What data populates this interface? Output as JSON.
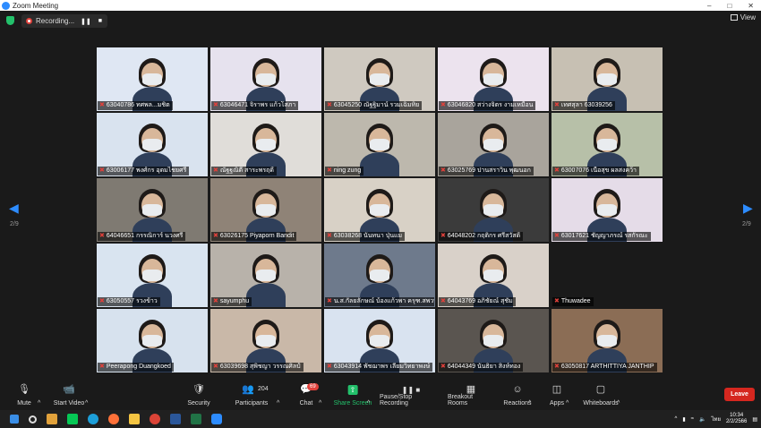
{
  "window": {
    "title": "Zoom Meeting"
  },
  "recording": {
    "status_label": "Recording..."
  },
  "view": {
    "label": "View"
  },
  "gallery": {
    "left_page": "2/9",
    "right_page": "2/9",
    "tiles": [
      {
        "name": "63040786 ทศพล...มชิต",
        "bg": "#dfe7f3"
      },
      {
        "name": "63046471 จิราพร แก้วโสภา",
        "bg": "#e6e2ee"
      },
      {
        "name": "63045250 ณัฐฐิมาน์ รวมเฉิมทิย",
        "bg": "#cfc9c0"
      },
      {
        "name": "63046820 สว่างจิตร งามเหมือน",
        "bg": "#ece3ee"
      },
      {
        "name": "เทศสุลา 63039256",
        "bg": "#c7c0b3"
      },
      {
        "name": "63006177 พงศ์กร อุดมไชยศรี",
        "bg": "#d9e3ef"
      },
      {
        "name": "ณัฐฐณิดี สาระพรฤดิ์",
        "bg": "#e0ddd9"
      },
      {
        "name": "ning zung",
        "bg": "#bdb8ad"
      },
      {
        "name": "63025769 ปานสราวิน พุฒนอก",
        "bg": "#a9a49c"
      },
      {
        "name": "63007076 เนื้อสุข ผลสงคว้า",
        "bg": "#b7c0a8"
      },
      {
        "name": "64046651 กรรณิการ์ นวงศรี",
        "bg": "#7f7a72"
      },
      {
        "name": "63026175 Piyaporn Bandit",
        "bg": "#8f8377"
      },
      {
        "name": "63038268 นันทนา ปุ่นแม",
        "bg": "#d8d1c6"
      },
      {
        "name": "64048202 กฤติกร ศรีสวัสดิ์",
        "bg": "#3b3b3b"
      },
      {
        "name": "63017621 ชัญญาภรณ์ รสกัรณะ",
        "bg": "#e5dce8"
      },
      {
        "name": "63050557 รวงข้าว",
        "bg": "#d9e4f0"
      },
      {
        "name": "sayumphu",
        "bg": "#b8b2aa"
      },
      {
        "name": "น.ส.กัลยลักษณ์ บ้องแก้วพา ครุฑ.สพวพง.",
        "bg": "#6e7a8c"
      },
      {
        "name": "64043769 อภิชัยณ์ สุชัม",
        "bg": "#d9d1c9"
      },
      {
        "name": "Thuwadee",
        "bg": "#1a1a1a"
      },
      {
        "name": "Peerapong Duangkoed",
        "bg": "#d7e2ee"
      },
      {
        "name": "63039698 สุพิชญา วรรณศิลป์",
        "bg": "#c9b8a8"
      },
      {
        "name": "63043914 พัชฌาพร เลียมวิทยาพงษ์",
        "bg": "#d9e3f0"
      },
      {
        "name": "64044349 นันธิยา สิงห์ทอง",
        "bg": "#5a5550"
      },
      {
        "name": "63050817 ARTHITTIYA JANTHIP",
        "bg": "#8b6d55"
      }
    ]
  },
  "toolbar": {
    "mute": "Mute",
    "start_video": "Start Video",
    "security": "Security",
    "participants": "Participants",
    "participants_count": "204",
    "chat": "Chat",
    "chat_badge": "69",
    "share_screen": "Share Screen",
    "recording": "Pause/Stop Recording",
    "breakout": "Breakout Rooms",
    "reactions": "Reactions",
    "apps": "Apps",
    "whiteboards": "Whiteboards",
    "leave": "Leave"
  },
  "taskbar": {
    "lang": "ไทย",
    "time": "10:34",
    "date": "2/2/2566"
  }
}
